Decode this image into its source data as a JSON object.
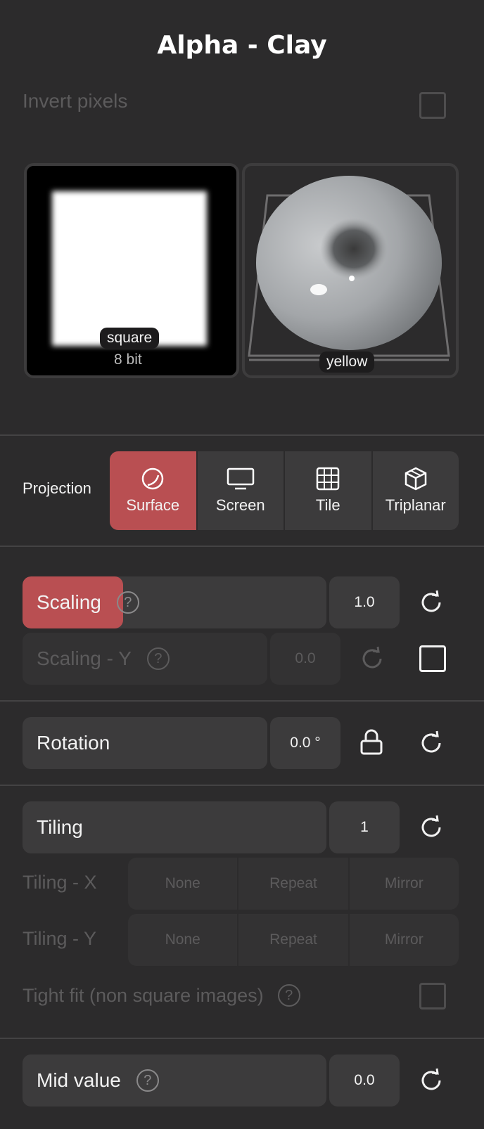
{
  "title": "Alpha - Clay",
  "invert_pixels": {
    "label": "Invert pixels",
    "checked": false
  },
  "alpha_preview": {
    "name": "square",
    "depth": "8 bit"
  },
  "material_preview": {
    "name": "yellow"
  },
  "projection": {
    "label": "Projection",
    "options": [
      {
        "label": "Surface",
        "icon": "surface-icon",
        "active": true
      },
      {
        "label": "Screen",
        "icon": "monitor-icon",
        "active": false
      },
      {
        "label": "Tile",
        "icon": "grid-icon",
        "active": false
      },
      {
        "label": "Triplanar",
        "icon": "cube-icon",
        "active": false
      }
    ]
  },
  "scaling": {
    "label": "Scaling",
    "value": "1.0",
    "fill_fraction": 0.33
  },
  "scaling_y": {
    "label": "Scaling - Y",
    "value": "0.0",
    "checked": false
  },
  "rotation": {
    "label": "Rotation",
    "value": "0.0 °"
  },
  "tiling": {
    "label": "Tiling",
    "value": "1"
  },
  "tiling_x": {
    "label": "Tiling - X",
    "options": [
      "None",
      "Repeat",
      "Mirror"
    ]
  },
  "tiling_y": {
    "label": "Tiling - Y",
    "options": [
      "None",
      "Repeat",
      "Mirror"
    ]
  },
  "tight_fit": {
    "label": "Tight fit (non square images)",
    "checked": false
  },
  "mid_value": {
    "label": "Mid value",
    "value": "0.0"
  },
  "colors": {
    "accent": "#b94f52",
    "background": "#2c2b2c",
    "control": "#3c3b3c"
  }
}
